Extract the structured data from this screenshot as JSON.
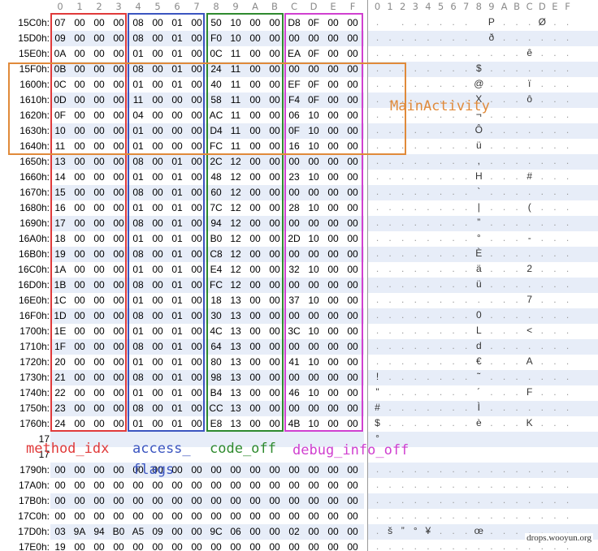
{
  "header": {
    "hex_columns": [
      "0",
      "1",
      "2",
      "3",
      "4",
      "5",
      "6",
      "7",
      "8",
      "9",
      "A",
      "B",
      "C",
      "D",
      "E",
      "F"
    ],
    "ascii_columns": [
      "0",
      "1",
      "2",
      "3",
      "4",
      "5",
      "6",
      "7",
      "8",
      "9",
      "A",
      "B",
      "C",
      "D",
      "E",
      "F"
    ]
  },
  "rows": [
    {
      "addr": "15C0h:",
      "bytes": [
        "07",
        "00",
        "00",
        "00",
        "08",
        "00",
        "01",
        "00",
        "50",
        "10",
        "00",
        "00",
        "D8",
        "0F",
        "00",
        "00"
      ],
      "ascii": [
        ".",
        "",
        ".",
        ".",
        ".",
        ".",
        ".",
        ".",
        "",
        "P",
        ".",
        ".",
        ".",
        "Ø",
        ".",
        "."
      ]
    },
    {
      "addr": "15D0h:",
      "bytes": [
        "09",
        "00",
        "00",
        "00",
        "08",
        "00",
        "01",
        "00",
        "F0",
        "10",
        "00",
        "00",
        "00",
        "00",
        "00",
        "00"
      ],
      "ascii": [
        ".",
        ".",
        ".",
        ".",
        ".",
        ".",
        ".",
        ".",
        "",
        "ð",
        ".",
        ".",
        ".",
        ".",
        ".",
        "."
      ]
    },
    {
      "addr": "15E0h:",
      "bytes": [
        "0A",
        "00",
        "00",
        "00",
        "01",
        "00",
        "01",
        "00",
        "0C",
        "11",
        "00",
        "00",
        "EA",
        "0F",
        "00",
        "00"
      ],
      "ascii": [
        ".",
        ".",
        ".",
        ".",
        ".",
        ".",
        ".",
        ".",
        ".",
        ".",
        ".",
        ".",
        "ê",
        ".",
        ".",
        "."
      ]
    },
    {
      "addr": "15F0h:",
      "bytes": [
        "0B",
        "00",
        "00",
        "00",
        "08",
        "00",
        "01",
        "00",
        "24",
        "11",
        "00",
        "00",
        "00",
        "00",
        "00",
        "00"
      ],
      "ascii": [
        ".",
        ".",
        ".",
        ".",
        ".",
        ".",
        ".",
        ".",
        "$",
        ".",
        ".",
        ".",
        ".",
        ".",
        ".",
        "."
      ]
    },
    {
      "addr": "1600h:",
      "bytes": [
        "0C",
        "00",
        "00",
        "00",
        "01",
        "00",
        "01",
        "00",
        "40",
        "11",
        "00",
        "00",
        "EF",
        "0F",
        "00",
        "00"
      ],
      "ascii": [
        ".",
        ".",
        ".",
        ".",
        ".",
        ".",
        ".",
        ".",
        "@",
        ".",
        ".",
        ".",
        "ï",
        ".",
        ".",
        "."
      ]
    },
    {
      "addr": "1610h:",
      "bytes": [
        "0D",
        "00",
        "00",
        "00",
        "11",
        "00",
        "00",
        "00",
        "58",
        "11",
        "00",
        "00",
        "F4",
        "0F",
        "00",
        "00"
      ],
      "ascii": [
        ".",
        ".",
        ".",
        ".",
        ".",
        ".",
        ".",
        ".",
        "X",
        ".",
        ".",
        ".",
        "ô",
        ".",
        ".",
        "."
      ]
    },
    {
      "addr": "1620h:",
      "bytes": [
        "0F",
        "00",
        "00",
        "00",
        "04",
        "00",
        "00",
        "00",
        "AC",
        "11",
        "00",
        "00",
        "06",
        "10",
        "00",
        "00"
      ],
      "ascii": [
        ".",
        ".",
        ".",
        ".",
        ".",
        ".",
        ".",
        ".",
        "¬",
        ".",
        ".",
        ".",
        ".",
        ".",
        ".",
        "."
      ]
    },
    {
      "addr": "1630h:",
      "bytes": [
        "10",
        "00",
        "00",
        "00",
        "01",
        "00",
        "00",
        "00",
        "D4",
        "11",
        "00",
        "00",
        "0F",
        "10",
        "00",
        "00"
      ],
      "ascii": [
        ".",
        ".",
        ".",
        ".",
        ".",
        ".",
        ".",
        ".",
        "Ô",
        ".",
        ".",
        ".",
        ".",
        ".",
        ".",
        "."
      ]
    },
    {
      "addr": "1640h:",
      "bytes": [
        "11",
        "00",
        "00",
        "00",
        "01",
        "00",
        "00",
        "00",
        "FC",
        "11",
        "00",
        "00",
        "16",
        "10",
        "00",
        "00"
      ],
      "ascii": [
        ".",
        ".",
        ".",
        ".",
        ".",
        ".",
        ".",
        ".",
        "ü",
        ".",
        ".",
        ".",
        ".",
        ".",
        ".",
        "."
      ]
    },
    {
      "addr": "1650h:",
      "bytes": [
        "13",
        "00",
        "00",
        "00",
        "08",
        "00",
        "01",
        "00",
        "2C",
        "12",
        "00",
        "00",
        "00",
        "00",
        "00",
        "00"
      ],
      "ascii": [
        ".",
        ".",
        ".",
        ".",
        ".",
        ".",
        ".",
        ".",
        ",",
        ".",
        ".",
        ".",
        ".",
        ".",
        ".",
        "."
      ]
    },
    {
      "addr": "1660h:",
      "bytes": [
        "14",
        "00",
        "00",
        "00",
        "01",
        "00",
        "01",
        "00",
        "48",
        "12",
        "00",
        "00",
        "23",
        "10",
        "00",
        "00"
      ],
      "ascii": [
        ".",
        ".",
        ".",
        ".",
        ".",
        ".",
        ".",
        ".",
        "H",
        ".",
        ".",
        ".",
        "#",
        ".",
        ".",
        "."
      ]
    },
    {
      "addr": "1670h:",
      "bytes": [
        "15",
        "00",
        "00",
        "00",
        "08",
        "00",
        "01",
        "00",
        "60",
        "12",
        "00",
        "00",
        "00",
        "00",
        "00",
        "00"
      ],
      "ascii": [
        ".",
        ".",
        ".",
        ".",
        ".",
        ".",
        ".",
        ".",
        "`",
        ".",
        ".",
        ".",
        ".",
        ".",
        ".",
        "."
      ]
    },
    {
      "addr": "1680h:",
      "bytes": [
        "16",
        "00",
        "00",
        "00",
        "01",
        "00",
        "01",
        "00",
        "7C",
        "12",
        "00",
        "00",
        "28",
        "10",
        "00",
        "00"
      ],
      "ascii": [
        ".",
        ".",
        ".",
        ".",
        ".",
        ".",
        ".",
        ".",
        "|",
        ".",
        ".",
        ".",
        "(",
        ".",
        ".",
        "."
      ]
    },
    {
      "addr": "1690h:",
      "bytes": [
        "17",
        "00",
        "00",
        "00",
        "08",
        "00",
        "01",
        "00",
        "94",
        "12",
        "00",
        "00",
        "00",
        "00",
        "00",
        "00"
      ],
      "ascii": [
        ".",
        ".",
        ".",
        ".",
        ".",
        ".",
        ".",
        ".",
        "”",
        ".",
        ".",
        ".",
        ".",
        ".",
        ".",
        "."
      ]
    },
    {
      "addr": "16A0h:",
      "bytes": [
        "18",
        "00",
        "00",
        "00",
        "01",
        "00",
        "01",
        "00",
        "B0",
        "12",
        "00",
        "00",
        "2D",
        "10",
        "00",
        "00"
      ],
      "ascii": [
        ".",
        ".",
        ".",
        ".",
        ".",
        ".",
        ".",
        ".",
        "°",
        ".",
        ".",
        ".",
        "-",
        ".",
        ".",
        "."
      ]
    },
    {
      "addr": "16B0h:",
      "bytes": [
        "19",
        "00",
        "00",
        "00",
        "08",
        "00",
        "01",
        "00",
        "C8",
        "12",
        "00",
        "00",
        "00",
        "00",
        "00",
        "00"
      ],
      "ascii": [
        ".",
        ".",
        ".",
        ".",
        ".",
        ".",
        ".",
        ".",
        "È",
        ".",
        ".",
        ".",
        ".",
        ".",
        ".",
        "."
      ]
    },
    {
      "addr": "16C0h:",
      "bytes": [
        "1A",
        "00",
        "00",
        "00",
        "01",
        "00",
        "01",
        "00",
        "E4",
        "12",
        "00",
        "00",
        "32",
        "10",
        "00",
        "00"
      ],
      "ascii": [
        ".",
        ".",
        ".",
        ".",
        ".",
        ".",
        ".",
        ".",
        "ä",
        ".",
        ".",
        ".",
        "2",
        ".",
        ".",
        "."
      ]
    },
    {
      "addr": "16D0h:",
      "bytes": [
        "1B",
        "00",
        "00",
        "00",
        "08",
        "00",
        "01",
        "00",
        "FC",
        "12",
        "00",
        "00",
        "00",
        "00",
        "00",
        "00"
      ],
      "ascii": [
        ".",
        ".",
        ".",
        ".",
        ".",
        ".",
        ".",
        ".",
        "ü",
        ".",
        ".",
        ".",
        ".",
        ".",
        ".",
        "."
      ]
    },
    {
      "addr": "16E0h:",
      "bytes": [
        "1C",
        "00",
        "00",
        "00",
        "01",
        "00",
        "01",
        "00",
        "18",
        "13",
        "00",
        "00",
        "37",
        "10",
        "00",
        "00"
      ],
      "ascii": [
        ".",
        ".",
        ".",
        ".",
        ".",
        ".",
        ".",
        ".",
        ".",
        ".",
        ".",
        ".",
        "7",
        ".",
        ".",
        "."
      ]
    },
    {
      "addr": "16F0h:",
      "bytes": [
        "1D",
        "00",
        "00",
        "00",
        "08",
        "00",
        "01",
        "00",
        "30",
        "13",
        "00",
        "00",
        "00",
        "00",
        "00",
        "00"
      ],
      "ascii": [
        ".",
        ".",
        ".",
        ".",
        ".",
        ".",
        ".",
        ".",
        "0",
        ".",
        ".",
        ".",
        ".",
        ".",
        ".",
        "."
      ]
    },
    {
      "addr": "1700h:",
      "bytes": [
        "1E",
        "00",
        "00",
        "00",
        "01",
        "00",
        "01",
        "00",
        "4C",
        "13",
        "00",
        "00",
        "3C",
        "10",
        "00",
        "00"
      ],
      "ascii": [
        ".",
        ".",
        ".",
        ".",
        ".",
        ".",
        ".",
        ".",
        "L",
        ".",
        ".",
        ".",
        "<",
        ".",
        ".",
        "."
      ]
    },
    {
      "addr": "1710h:",
      "bytes": [
        "1F",
        "00",
        "00",
        "00",
        "08",
        "00",
        "01",
        "00",
        "64",
        "13",
        "00",
        "00",
        "00",
        "00",
        "00",
        "00"
      ],
      "ascii": [
        ".",
        ".",
        ".",
        ".",
        ".",
        ".",
        ".",
        ".",
        "d",
        ".",
        ".",
        ".",
        ".",
        ".",
        ".",
        "."
      ]
    },
    {
      "addr": "1720h:",
      "bytes": [
        "20",
        "00",
        "00",
        "00",
        "01",
        "00",
        "01",
        "00",
        "80",
        "13",
        "00",
        "00",
        "41",
        "10",
        "00",
        "00"
      ],
      "ascii": [
        ".",
        ".",
        ".",
        ".",
        ".",
        ".",
        ".",
        ".",
        "€",
        ".",
        ".",
        ".",
        "A",
        ".",
        ".",
        "."
      ]
    },
    {
      "addr": "1730h:",
      "bytes": [
        "21",
        "00",
        "00",
        "00",
        "08",
        "00",
        "01",
        "00",
        "98",
        "13",
        "00",
        "00",
        "00",
        "00",
        "00",
        "00"
      ],
      "ascii": [
        "!",
        ".",
        ".",
        ".",
        ".",
        ".",
        ".",
        ".",
        "˜",
        ".",
        ".",
        ".",
        ".",
        ".",
        ".",
        "."
      ]
    },
    {
      "addr": "1740h:",
      "bytes": [
        "22",
        "00",
        "00",
        "00",
        "01",
        "00",
        "01",
        "00",
        "B4",
        "13",
        "00",
        "00",
        "46",
        "10",
        "00",
        "00"
      ],
      "ascii": [
        "\"",
        ".",
        ".",
        ".",
        ".",
        ".",
        ".",
        ".",
        "´",
        ".",
        ".",
        ".",
        "F",
        ".",
        ".",
        "."
      ]
    },
    {
      "addr": "1750h:",
      "bytes": [
        "23",
        "00",
        "00",
        "00",
        "08",
        "00",
        "01",
        "00",
        "CC",
        "13",
        "00",
        "00",
        "00",
        "00",
        "00",
        "00"
      ],
      "ascii": [
        "#",
        ".",
        ".",
        ".",
        ".",
        ".",
        ".",
        ".",
        "Ì",
        ".",
        ".",
        ".",
        ".",
        ".",
        ".",
        "."
      ]
    },
    {
      "addr": "1760h:",
      "bytes": [
        "24",
        "00",
        "00",
        "00",
        "01",
        "00",
        "01",
        "00",
        "E8",
        "13",
        "00",
        "00",
        "4B",
        "10",
        "00",
        "00"
      ],
      "ascii": [
        "$",
        ".",
        ".",
        ".",
        ".",
        ".",
        ".",
        ".",
        "è",
        ".",
        ".",
        ".",
        "K",
        ".",
        ".",
        "."
      ]
    },
    {
      "addr": "17",
      "bytes": [
        "",
        "",
        "",
        "",
        "",
        "",
        "",
        "",
        "",
        "",
        "",
        "",
        "",
        "",
        "",
        ""
      ],
      "ascii": [
        "°",
        "",
        "",
        "",
        "",
        "",
        "",
        "",
        "",
        "",
        "",
        "",
        "",
        "",
        "",
        ""
      ]
    },
    {
      "addr": "17",
      "bytes": [
        "",
        "",
        "",
        "",
        "",
        "",
        "",
        "",
        "",
        "",
        "",
        "",
        "",
        "",
        "",
        ""
      ],
      "ascii": [
        "",
        "",
        "",
        "",
        "",
        "",
        "",
        "",
        "",
        "",
        "",
        "",
        "",
        "",
        "",
        ""
      ]
    },
    {
      "addr": "1790h:",
      "bytes": [
        "00",
        "00",
        "00",
        "00",
        "00",
        "00",
        "00",
        "00",
        "00",
        "00",
        "00",
        "00",
        "00",
        "00",
        "00",
        "00"
      ],
      "ascii": [
        ".",
        ".",
        ".",
        ".",
        ".",
        ".",
        ".",
        ".",
        ".",
        ".",
        ".",
        ".",
        ".",
        ".",
        ".",
        "."
      ]
    },
    {
      "addr": "17A0h:",
      "bytes": [
        "00",
        "00",
        "00",
        "00",
        "00",
        "00",
        "00",
        "00",
        "00",
        "00",
        "00",
        "00",
        "00",
        "00",
        "00",
        "00"
      ],
      "ascii": [
        ".",
        ".",
        ".",
        ".",
        ".",
        ".",
        ".",
        ".",
        ".",
        ".",
        ".",
        ".",
        ".",
        ".",
        ".",
        "."
      ]
    },
    {
      "addr": "17B0h:",
      "bytes": [
        "00",
        "00",
        "00",
        "00",
        "00",
        "00",
        "00",
        "00",
        "00",
        "00",
        "00",
        "00",
        "00",
        "00",
        "00",
        "00"
      ],
      "ascii": [
        ".",
        ".",
        ".",
        ".",
        ".",
        ".",
        ".",
        ".",
        ".",
        ".",
        ".",
        ".",
        ".",
        ".",
        ".",
        "."
      ]
    },
    {
      "addr": "17C0h:",
      "bytes": [
        "00",
        "00",
        "00",
        "00",
        "00",
        "00",
        "00",
        "00",
        "00",
        "00",
        "00",
        "00",
        "00",
        "00",
        "00",
        "00"
      ],
      "ascii": [
        ".",
        ".",
        ".",
        ".",
        ".",
        ".",
        ".",
        ".",
        ".",
        ".",
        ".",
        ".",
        ".",
        ".",
        ".",
        "."
      ]
    },
    {
      "addr": "17D0h:",
      "bytes": [
        "03",
        "9A",
        "94",
        "B0",
        "A5",
        "09",
        "00",
        "00",
        "9C",
        "06",
        "00",
        "00",
        "02",
        "00",
        "00",
        "00"
      ],
      "ascii": [
        ".",
        "š",
        "”",
        "°",
        "¥",
        ".",
        ".",
        ".",
        "œ",
        ".",
        ".",
        ".",
        ".",
        ".",
        ".",
        "."
      ]
    },
    {
      "addr": "17E0h:",
      "bytes": [
        "19",
        "00",
        "00",
        "00",
        "00",
        "00",
        "00",
        "00",
        "00",
        "00",
        "00",
        "00",
        "00",
        "00",
        "00",
        "00"
      ],
      "ascii": [
        ".",
        ".",
        ".",
        ".",
        ".",
        ".",
        ".",
        ".",
        ".",
        ".",
        ".",
        ".",
        ".",
        ".",
        ".",
        "."
      ]
    }
  ],
  "annotations": {
    "method_idx": {
      "label": "method_idx",
      "color": "#e03a3a"
    },
    "access_flags": {
      "label_line1": "access_",
      "label_line2": "flags",
      "color": "#3b55c0"
    },
    "code_off": {
      "label": "code_off",
      "color": "#2e8a2e"
    },
    "debug_info_off": {
      "label": "debug_info_off",
      "color": "#d040d0"
    },
    "main_activity": {
      "label": "MainActivity",
      "color": "#e08a3a"
    }
  },
  "watermark": "drops.wooyun.org"
}
